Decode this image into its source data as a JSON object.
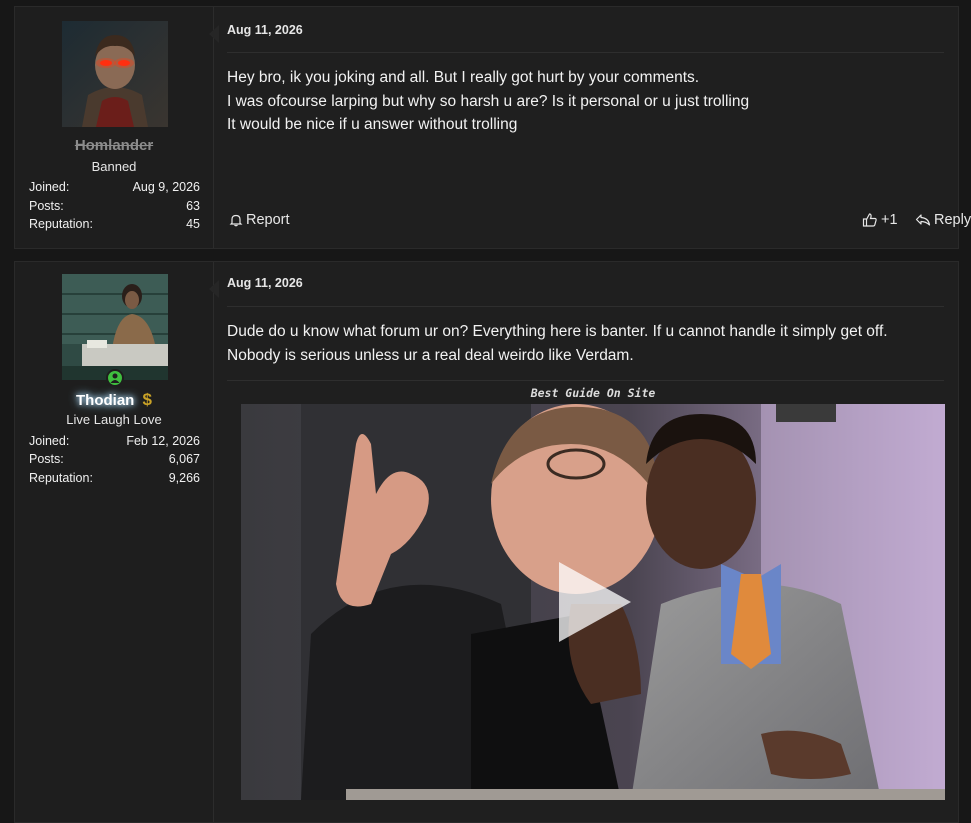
{
  "posts": [
    {
      "author": {
        "name": "Homlander",
        "title": "Banned",
        "joined_label": "Joined:",
        "joined": "Aug 9, 2026",
        "posts_label": "Posts:",
        "posts": "63",
        "reputation_label": "Reputation:",
        "reputation": "45"
      },
      "date": "Aug 11, 2026",
      "lines": [
        "Hey bro, ik you joking and all. But I really got hurt by your comments.",
        "I was ofcourse larping but why so harsh u are? Is it personal or u just trolling",
        "It would be nice if u answer without trolling"
      ],
      "actions": {
        "report": "Report",
        "like": "+1",
        "reply": "Reply"
      }
    },
    {
      "author": {
        "name": "Thodian",
        "title": "Live Laugh Love",
        "joined_label": "Joined:",
        "joined": "Feb 12, 2026",
        "posts_label": "Posts:",
        "posts": "6,067",
        "reputation_label": "Reputation:",
        "reputation": "9,266"
      },
      "date": "Aug 11, 2026",
      "lines": [
        "Dude do u know what forum ur on? Everything here is banter. If u cannot handle it simply get off.",
        "Nobody is serious unless ur a real deal weirdo like Verdam."
      ],
      "video": {
        "caption": "Best Guide On Site"
      }
    }
  ],
  "colors": {
    "page_bg": "#171717",
    "post_bg": "#1f1f1f",
    "banned_name": "#8c8c8c",
    "name_glow": "#ffffff",
    "online": "#3fbf3f",
    "gold": "#c9a227"
  }
}
